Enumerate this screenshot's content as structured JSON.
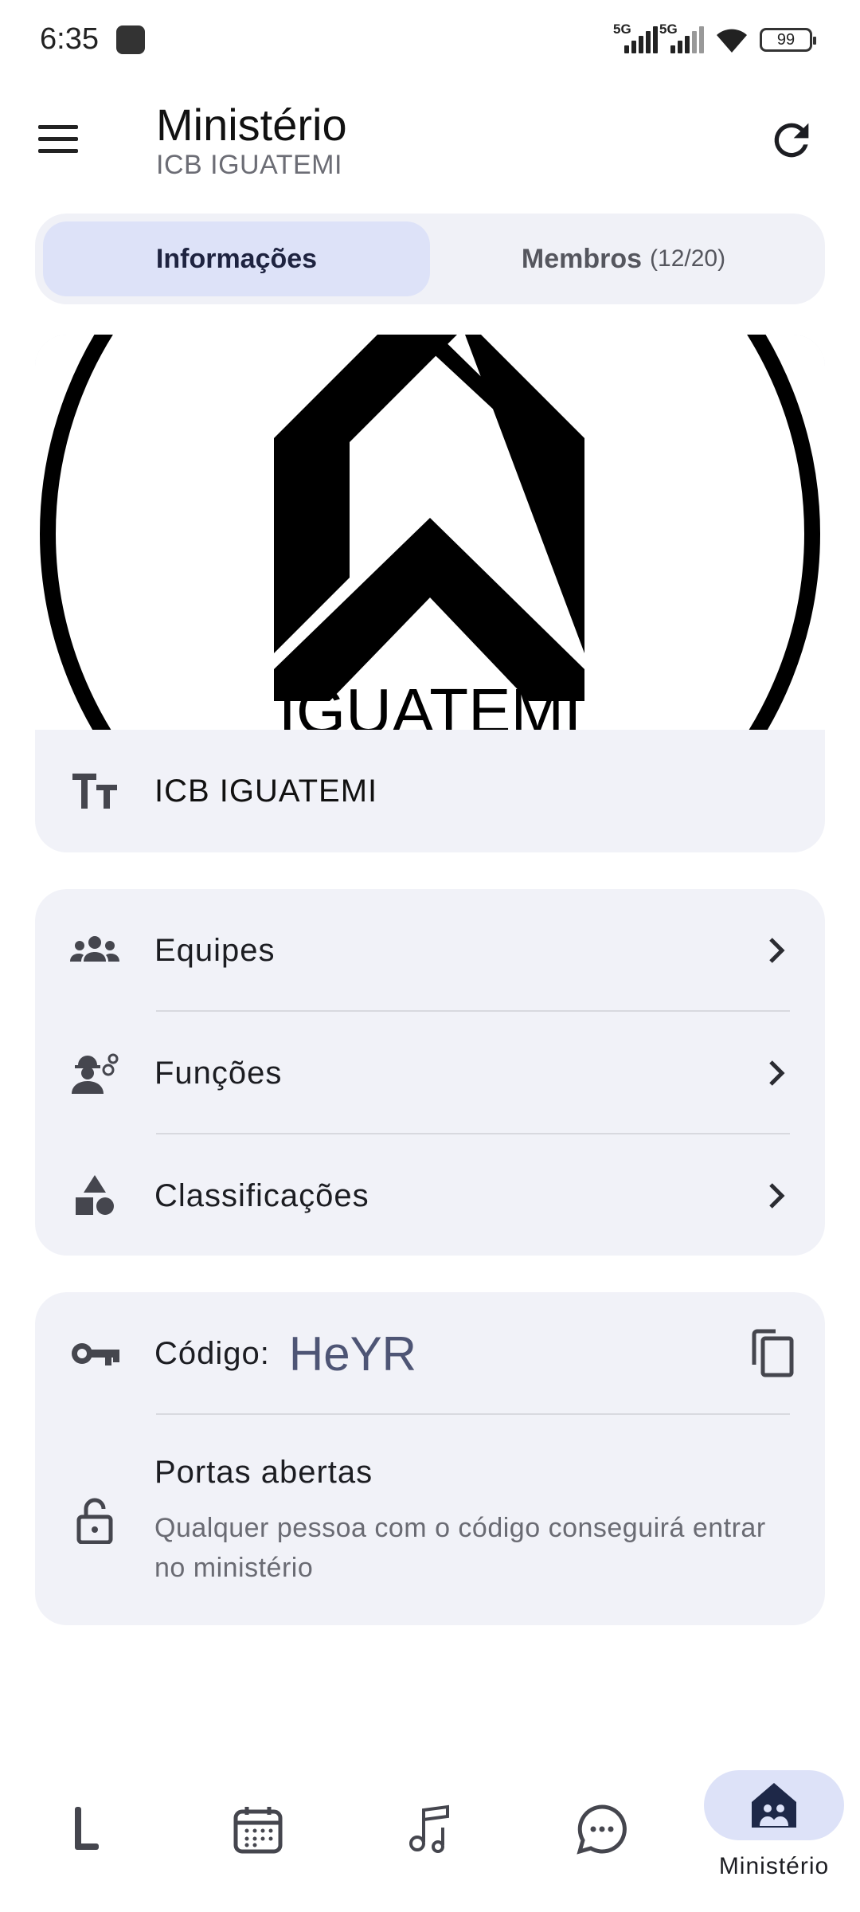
{
  "status_bar": {
    "time": "6:35",
    "network_1": "5G",
    "network_2": "5G",
    "battery": "99"
  },
  "app_bar": {
    "title": "Ministério",
    "subtitle": "ICB IGUATEMI"
  },
  "tabs": [
    {
      "label": "Informações",
      "count": "",
      "active": true
    },
    {
      "label": "Membros",
      "count": "(12/20)",
      "active": false
    }
  ],
  "ministry": {
    "logo_text": "IGUATEMI",
    "name": "ICB IGUATEMI"
  },
  "menu": {
    "items": [
      {
        "label": "Equipes",
        "icon": "groups-icon"
      },
      {
        "label": "Funções",
        "icon": "engineer-gear-icon"
      },
      {
        "label": "Classificações",
        "icon": "shapes-icon"
      }
    ]
  },
  "access": {
    "code_label": "Código:",
    "code_value": "HeYR",
    "open_title": "Portas abertas",
    "open_description": "Qualquer pessoa com o código conseguirá entrar no ministério"
  },
  "bottom_nav": [
    {
      "icon": "stand-icon",
      "label": "",
      "active": false
    },
    {
      "icon": "calendar-icon",
      "label": "",
      "active": false
    },
    {
      "icon": "music-notes-icon",
      "label": "",
      "active": false
    },
    {
      "icon": "chat-icon",
      "label": "",
      "active": false
    },
    {
      "icon": "ministry-icon",
      "label": "Ministério",
      "active": true
    }
  ],
  "colors": {
    "accent_pill": "#dde2f8",
    "card_bg": "#f1f2f8",
    "code_text": "#4e5575"
  }
}
